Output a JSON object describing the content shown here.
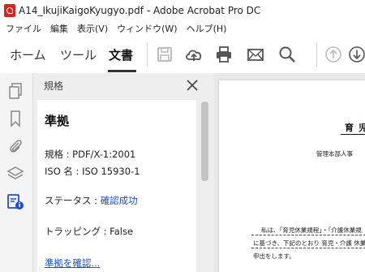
{
  "window": {
    "title": "A14_IkujiKaigoKyugyo.pdf - Adobe Acrobat Pro DC"
  },
  "menu": [
    "ファイル",
    "編集",
    "表示(V)",
    "ウィンドウ(W)",
    "ヘルプ(H)"
  ],
  "toolbar": {
    "tabs": [
      "ホーム",
      "ツール",
      "文書"
    ],
    "active_tab": "文書",
    "icons": [
      "save-icon",
      "upload-cloud-icon",
      "print-icon",
      "email-icon",
      "search-icon",
      "page-up-icon",
      "page-down-icon"
    ]
  },
  "left_rail": {
    "icons": [
      "pages-icon",
      "bookmark-icon",
      "attachment-icon",
      "layers-icon",
      "standards-icon"
    ],
    "active_icon": "standards-icon"
  },
  "panel": {
    "title": "規格",
    "heading": "準拠",
    "standard_label": "規格 : PDF/X-1:2001",
    "iso_label": "ISO 名 : ISO 15930-1",
    "status_label": "ステータス : ",
    "status_value": "確認成功",
    "trapping_label": "トラッピング : False",
    "verify_link": "準拠を確認..."
  },
  "document": {
    "title": "育児",
    "dept": "管理本部人事",
    "para1": "私は、「育児休業規程」・「介護休業規",
    "para2": "に基づき、下記のとおり 育児・介護 休業",
    "para3": "申出をします。"
  },
  "colors": {
    "link": "#1a4fd6",
    "acrobat_red": "#d8231e",
    "active_rail_icon": "#1a4fd6"
  }
}
